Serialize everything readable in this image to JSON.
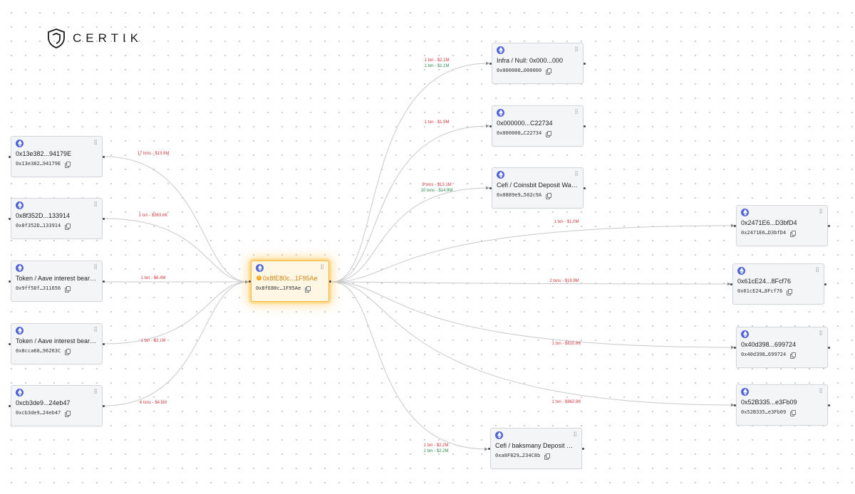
{
  "brand": {
    "name": "CERTIK"
  },
  "colors": {
    "outflow": "#d0363c",
    "inflow": "#2d8a4a",
    "highlight": "#f0b53a",
    "chain": "#4f63d8"
  },
  "nodes": {
    "center": {
      "title": "0x8fE80c...1F95Ae",
      "address": "0x8fE80c…1F95Ae",
      "icon": "ethereum-icon",
      "flag": "warning-icon"
    },
    "src1": {
      "title": "0x13e382...94179E",
      "address": "0x13e382…94179E",
      "icon": "ethereum-icon"
    },
    "src2": {
      "title": "0x8f352D...133914",
      "address": "0x8f352D…133914",
      "icon": "ethereum-icon"
    },
    "src3": {
      "title": "Token / Aave interest bearing ...",
      "address": "0x9ff58f…311656",
      "icon": "ethereum-icon"
    },
    "src4": {
      "title": "Token / Aave interest bearing ...",
      "address": "0x8cca60…96263C",
      "icon": "ethereum-icon"
    },
    "src5": {
      "title": "0xcb3de9...24eb47",
      "address": "0xcb3de9…24eb47",
      "icon": "ethereum-icon"
    },
    "dst1": {
      "title": "Infra / Null: 0x000...000",
      "address": "0x000000…000000",
      "icon": "ethereum-icon"
    },
    "dst2": {
      "title": "0x000000...C22734",
      "address": "0x000000…C22734",
      "icon": "ethereum-icon"
    },
    "dst3": {
      "title": "Cefi / Coinsbit Deposit Wallet",
      "address": "0x0889e9…502c9A",
      "icon": "ethereum-icon"
    },
    "dst4": {
      "title": "0x2471E6...D3bfD4",
      "address": "0x2471E6…D3bfD4",
      "icon": "ethereum-icon"
    },
    "dst5": {
      "title": "0x61cE24...8Fcf76",
      "address": "0x61cE24…8Fcf76",
      "icon": "ethereum-icon"
    },
    "dst6": {
      "title": "0x40d398...699724",
      "address": "0x40d398…699724",
      "icon": "ethereum-icon"
    },
    "dst7": {
      "title": "0x52B335...e3Fb09",
      "address": "0x52B335…e3Fb09",
      "icon": "ethereum-icon"
    },
    "dst8": {
      "title": "Cefi / baksmany Deposit Wallet",
      "address": "0xa8F829…234C8b",
      "icon": "ethereum-icon"
    }
  },
  "edges": {
    "src1": {
      "out": "17 txns - $13.9M"
    },
    "src2": {
      "out": "1 txn - $563.6K"
    },
    "src3": {
      "out": "1 txn - $6.4M"
    },
    "src4": {
      "out": "1 txn - $2.1M"
    },
    "src5": {
      "out": "6 txns - $4.5M"
    },
    "dst1": {
      "out": "1 txn - $2.1M",
      "in": "1 txn - $1.1M"
    },
    "dst2": {
      "out": "1 txn - $1.9M"
    },
    "dst3": {
      "out": "9 txns - $13.1M",
      "in": "10 txns - $14.9M"
    },
    "dst4": {
      "out": "1 txn - $1.0M"
    },
    "dst5": {
      "out": "2 txns - $19.9M"
    },
    "dst6": {
      "out": "1 txn - $810.6K"
    },
    "dst7": {
      "out": "1 txn - $862.8K"
    },
    "dst8": {
      "out": "1 txn - $2.2M",
      "in": "1 txn - $2.2M"
    }
  }
}
